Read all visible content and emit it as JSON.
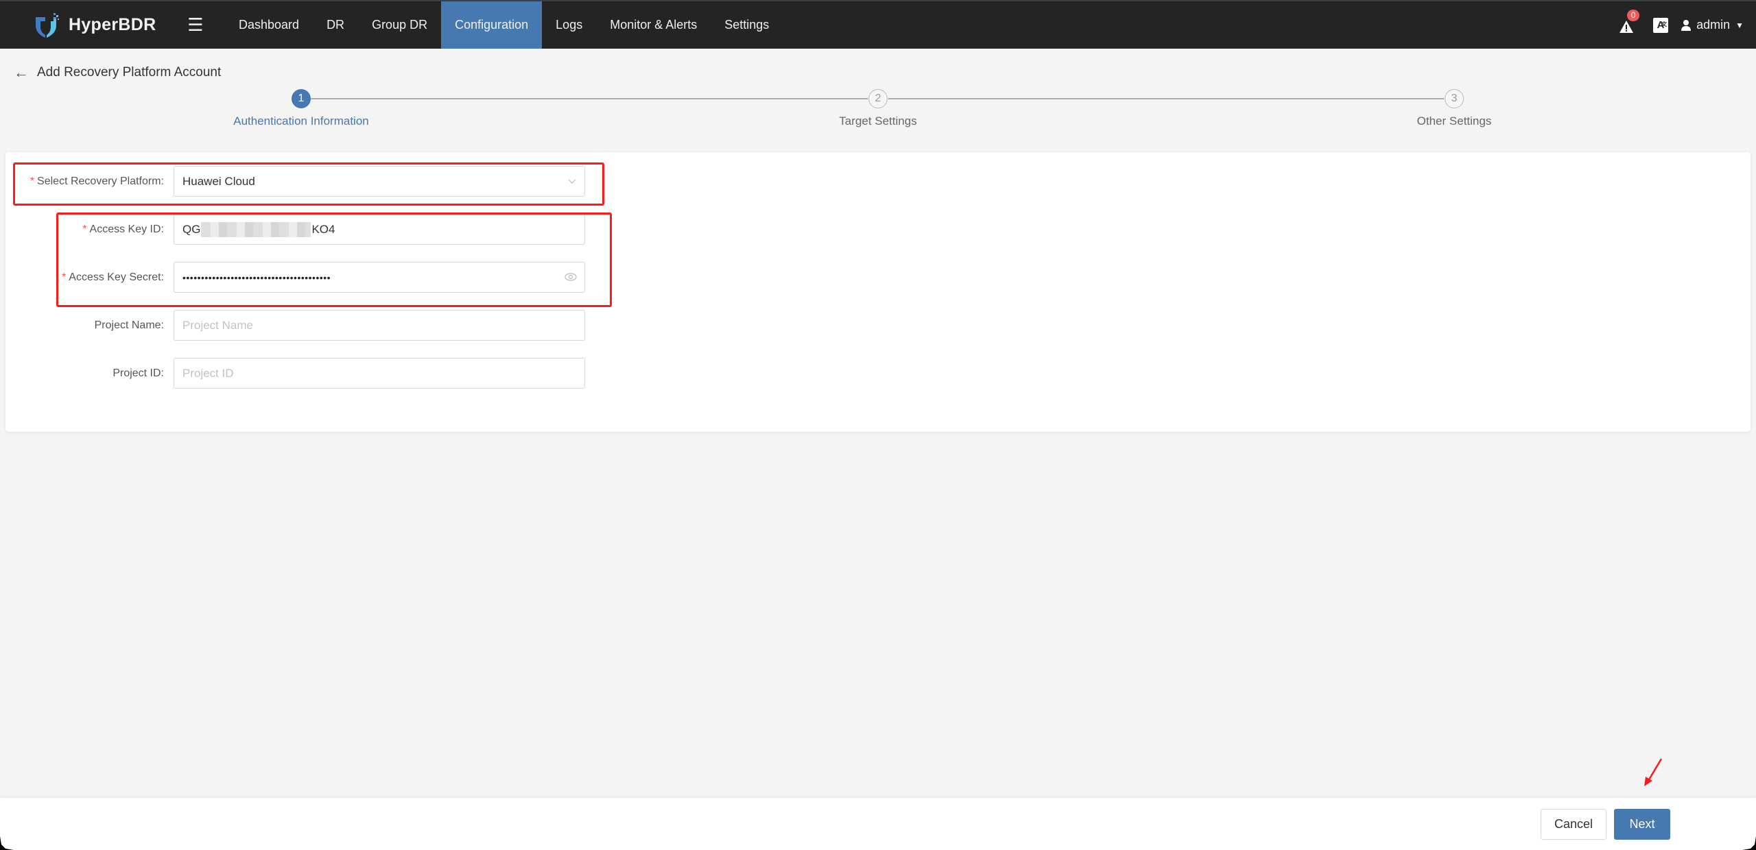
{
  "app": {
    "brand": "HyperBDR",
    "menu_icon": "hamburger-icon"
  },
  "nav": {
    "items": [
      {
        "label": "Dashboard",
        "active": false
      },
      {
        "label": "DR",
        "active": false
      },
      {
        "label": "Group DR",
        "active": false
      },
      {
        "label": "Configuration",
        "active": true
      },
      {
        "label": "Logs",
        "active": false
      },
      {
        "label": "Monitor & Alerts",
        "active": false
      },
      {
        "label": "Settings",
        "active": false
      }
    ],
    "alert_count": "0",
    "language_icon": "A",
    "language_sup": "文",
    "user": "admin"
  },
  "page": {
    "title": "Add Recovery Platform Account",
    "back_icon": "arrow-left-icon"
  },
  "steps": [
    {
      "number": "1",
      "label": "Authentication Information",
      "status": "active"
    },
    {
      "number": "2",
      "label": "Target Settings",
      "status": "pending"
    },
    {
      "number": "3",
      "label": "Other Settings",
      "status": "pending"
    }
  ],
  "form": {
    "platform": {
      "label": "Select Recovery Platform:",
      "required": true,
      "value": "Huawei Cloud"
    },
    "access_key_id": {
      "label": "Access Key ID:",
      "required": true,
      "value_prefix": "QG",
      "value_suffix": "KO4",
      "masked_middle": true
    },
    "access_key_secret": {
      "label": "Access Key Secret:",
      "required": true,
      "value": "••••••••••••••••••••••••••••••••••••••••"
    },
    "project_name": {
      "label": "Project Name:",
      "required": false,
      "value": "",
      "placeholder": "Project Name"
    },
    "project_id": {
      "label": "Project ID:",
      "required": false,
      "value": "",
      "placeholder": "Project ID"
    }
  },
  "footer": {
    "cancel_label": "Cancel",
    "next_label": "Next"
  },
  "colors": {
    "accent": "#4579b0",
    "navbar": "#242424",
    "annotation": "#ff1a1a",
    "required": "#ee5555",
    "badge": "#ec5b5b"
  }
}
